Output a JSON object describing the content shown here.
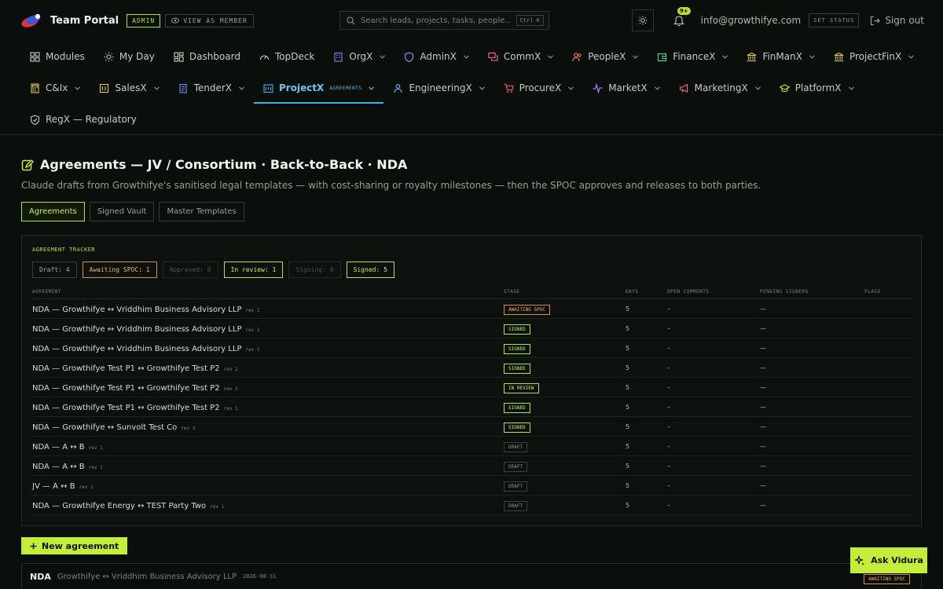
{
  "app": {
    "title": "Team Portal",
    "role_badge": "ADMIN",
    "view_as_label": "VIEW AS MEMBER"
  },
  "search": {
    "placeholder": "Search leads, projects, tasks, people...",
    "shortcut": "Ctrl K"
  },
  "header": {
    "notification_count": "9+",
    "user_email": "info@growthifye.com",
    "set_status_label": "SET STATUS",
    "sign_out_label": "Sign out"
  },
  "nav": {
    "row1": [
      {
        "label": "Modules",
        "icon": "grid-icon",
        "dropdown": false
      },
      {
        "label": "My Day",
        "icon": "sun-icon",
        "dropdown": false
      },
      {
        "label": "Dashboard",
        "icon": "dashboard-icon",
        "dropdown": false
      },
      {
        "label": "TopDeck",
        "icon": "gauge-icon",
        "dropdown": false
      },
      {
        "label": "OrgX",
        "icon": "building-icon",
        "dropdown": true
      },
      {
        "label": "AdminX",
        "icon": "shield-icon",
        "dropdown": true
      },
      {
        "label": "CommX",
        "icon": "chat-icon",
        "dropdown": true
      },
      {
        "label": "PeopleX",
        "icon": "people-icon",
        "dropdown": true
      },
      {
        "label": "FinanceX",
        "icon": "wallet-icon",
        "dropdown": true
      },
      {
        "label": "FinManX",
        "icon": "bank-icon",
        "dropdown": true
      },
      {
        "label": "ProjectFinX",
        "icon": "bank-icon",
        "dropdown": true
      }
    ],
    "row2": [
      {
        "label": "C&Ix",
        "icon": "calculator-icon",
        "dropdown": true
      },
      {
        "label": "SalesX",
        "icon": "sales-icon",
        "dropdown": true
      },
      {
        "label": "TenderX",
        "icon": "tender-icon",
        "dropdown": true
      },
      {
        "label": "ProjectX",
        "icon": "project-icon",
        "dropdown": true,
        "sub": "AGREEMENTS"
      },
      {
        "label": "EngineeringX",
        "icon": "engineer-icon",
        "dropdown": true
      },
      {
        "label": "ProcureX",
        "icon": "cart-icon",
        "dropdown": true
      },
      {
        "label": "MarketX",
        "icon": "pulse-icon",
        "dropdown": true
      },
      {
        "label": "MarketingX",
        "icon": "megaphone-icon",
        "dropdown": true
      },
      {
        "label": "PlatformX",
        "icon": "graduation-icon",
        "dropdown": true
      }
    ],
    "row3": [
      {
        "label": "RegX — Regulatory",
        "icon": "shield-check-icon",
        "dropdown": false
      }
    ]
  },
  "page": {
    "title": "Agreements — JV / Consortium · Back-to-Back · NDA",
    "subtitle": "Claude drafts from Growthifye's sanitised legal templates — with cost-sharing or royalty milestones — then the SPOC approves and releases to both parties.",
    "tabs": [
      "Agreements",
      "Signed Vault",
      "Master Templates"
    ],
    "active_tab": 0
  },
  "tracker": {
    "label": "AGREEMENT TRACKER",
    "chips": [
      {
        "label": "Draft: 4",
        "style": "default"
      },
      {
        "label": "Awaiting SPOC: 1",
        "style": "awaiting"
      },
      {
        "label": "Approved: 0",
        "style": "dim"
      },
      {
        "label": "In review: 1",
        "style": "green"
      },
      {
        "label": "Signing: 0",
        "style": "dim"
      },
      {
        "label": "Signed: 5",
        "style": "green"
      }
    ],
    "columns": [
      "AGREEMENT",
      "STAGE",
      "DAYS",
      "OPEN COMMENTS",
      "PENDING SIGNERS",
      "FLAGS"
    ],
    "rows": [
      {
        "name": "NDA — Growthifye ↔ Vriddhim Business Advisory LLP",
        "rev": "rev 1",
        "stage": "AWAITING SPOC",
        "stage_style": "awaiting",
        "days": "5",
        "comments": "–",
        "signers": "—",
        "flags": ""
      },
      {
        "name": "NDA — Growthifye ↔ Vriddhim Business Advisory LLP",
        "rev": "rev 1",
        "stage": "SIGNED",
        "stage_style": "signed",
        "days": "5",
        "comments": "–",
        "signers": "—",
        "flags": ""
      },
      {
        "name": "NDA — Growthifye ↔ Vriddhim Business Advisory LLP",
        "rev": "rev 1",
        "stage": "SIGNED",
        "stage_style": "signed",
        "days": "5",
        "comments": "–",
        "signers": "—",
        "flags": ""
      },
      {
        "name": "NDA — Growthifye Test P1 ↔ Growthifye Test P2",
        "rev": "rev 2",
        "stage": "SIGNED",
        "stage_style": "signed",
        "days": "5",
        "comments": "–",
        "signers": "—",
        "flags": ""
      },
      {
        "name": "NDA — Growthifye Test P1 ↔ Growthifye Test P2",
        "rev": "rev 1",
        "stage": "IN REVIEW",
        "stage_style": "review",
        "days": "5",
        "comments": "–",
        "signers": "—",
        "flags": ""
      },
      {
        "name": "NDA — Growthifye Test P1 ↔ Growthifye Test P2",
        "rev": "rev 1",
        "stage": "SIGNED",
        "stage_style": "signed",
        "days": "5",
        "comments": "–",
        "signers": "—",
        "flags": ""
      },
      {
        "name": "NDA — Growthifye ↔ Sunvolt Test Co",
        "rev": "rev 3",
        "stage": "SIGNED",
        "stage_style": "signed",
        "days": "5",
        "comments": "–",
        "signers": "—",
        "flags": ""
      },
      {
        "name": "NDA — A ↔ B",
        "rev": "rev 1",
        "stage": "DRAFT",
        "stage_style": "draft",
        "days": "5",
        "comments": "–",
        "signers": "—",
        "flags": ""
      },
      {
        "name": "NDA — A ↔ B",
        "rev": "rev 1",
        "stage": "DRAFT",
        "stage_style": "draft",
        "days": "5",
        "comments": "–",
        "signers": "—",
        "flags": ""
      },
      {
        "name": "JV — A ↔ B",
        "rev": "rev 1",
        "stage": "DRAFT",
        "stage_style": "draft",
        "days": "5",
        "comments": "–",
        "signers": "—",
        "flags": ""
      },
      {
        "name": "NDA — Growthifye Energy ↔ TEST Party Two",
        "rev": "rev 1",
        "stage": "DRAFT",
        "stage_style": "draft",
        "days": "5",
        "comments": "–",
        "signers": "—",
        "flags": ""
      }
    ]
  },
  "actions": {
    "new_agreement_label": "New agreement",
    "ask_label": "Ask Vidura"
  },
  "bottom_card": {
    "type": "NDA",
    "parties": "Growthifye ↔ Vriddhim Business Advisory LLP",
    "date": "2026-08-31",
    "stage": "AWAITING SPOC"
  },
  "colors": {
    "accent": "#c4ec3a",
    "active_nav": "#3fb0e8",
    "awaiting": "#d98e3e",
    "background": "#0b0f0c"
  }
}
